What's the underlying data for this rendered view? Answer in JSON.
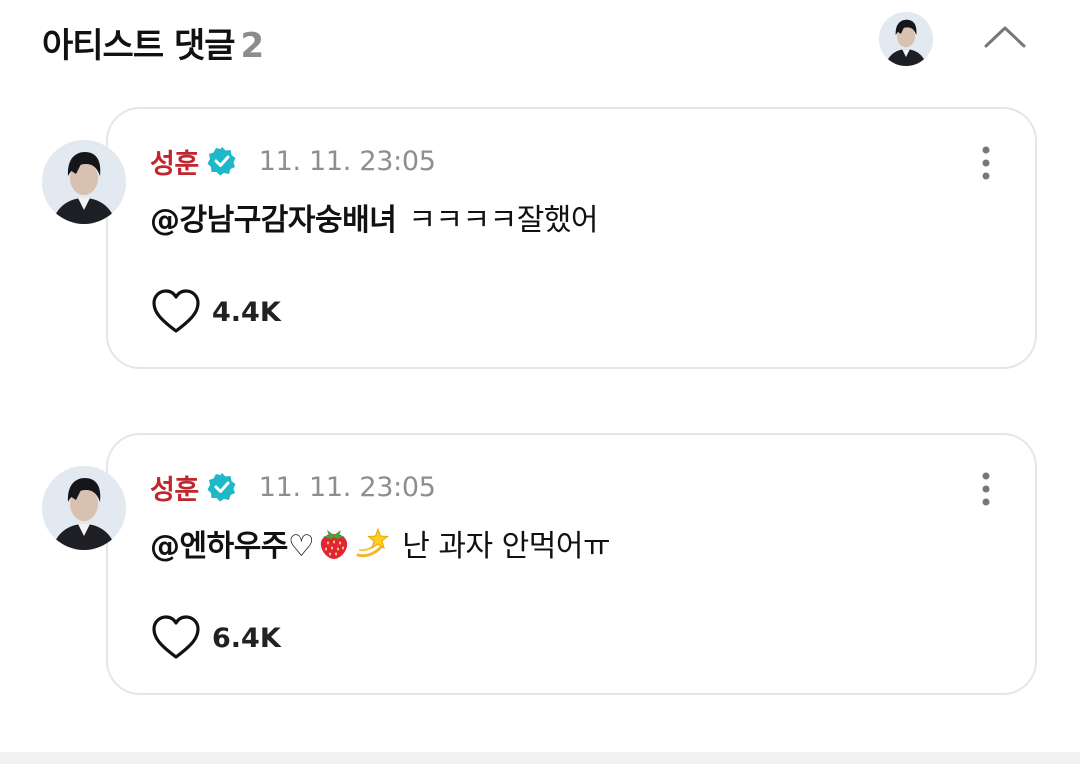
{
  "header": {
    "title": "아티스트 댓글",
    "count": "2",
    "avatar_icon": "artist-avatar",
    "collapse_icon": "chevron-up-icon"
  },
  "comments": [
    {
      "author": "성훈",
      "verified_icon": "verified-badge-icon",
      "timestamp": "11. 11. 23:05",
      "mention": "@강남구감자숭배녀",
      "text": "ㅋㅋㅋㅋ잘했어",
      "likes": "4.4K"
    },
    {
      "author": "성훈",
      "verified_icon": "verified-badge-icon",
      "timestamp": "11. 11. 23:05",
      "mention": "@엔하우주♡",
      "emojis": [
        "strawberry-emoji",
        "dizzy-star-emoji"
      ],
      "text": "난 과자 안먹어ㅠ",
      "likes": "6.4K"
    }
  ],
  "colors": {
    "author": "#c0262d",
    "verified": "#1fb8c8",
    "timestamp": "#8e8e8e",
    "border": "#e6e6e6",
    "count": "#8c8c8c"
  }
}
